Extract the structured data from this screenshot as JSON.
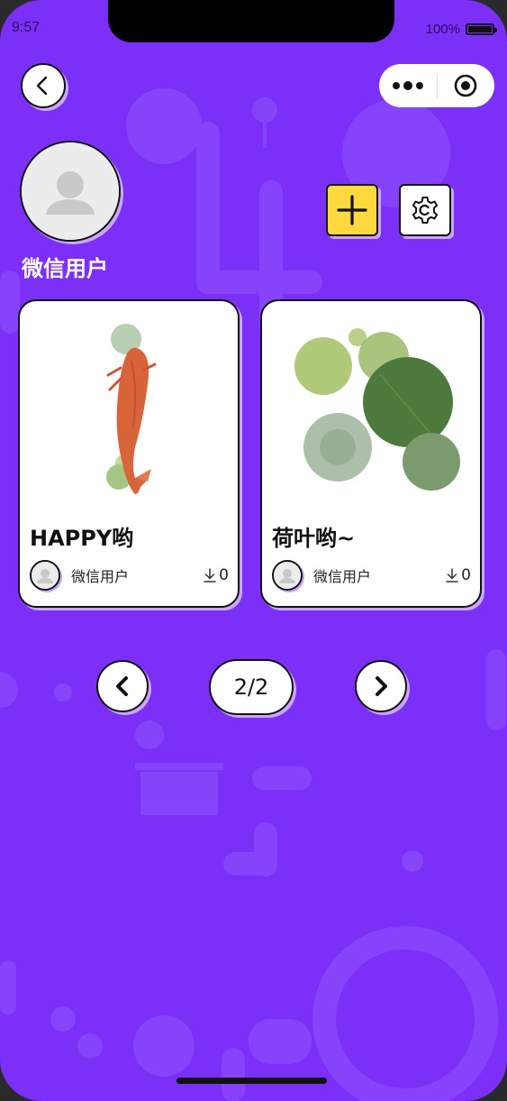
{
  "status_bar": {
    "time": "9:57",
    "battery": "100%"
  },
  "profile": {
    "username": "微信用户"
  },
  "cards": [
    {
      "title": "HAPPY哟",
      "author": "微信用户",
      "downloads": "0"
    },
    {
      "title": "荷叶哟~",
      "author": "微信用户",
      "downloads": "0"
    }
  ],
  "pagination": {
    "indicator": "2/2"
  },
  "colors": {
    "background": "#7b2ff7",
    "accent_shadow": "#c9a6ff",
    "add_button": "#ffd93d"
  }
}
